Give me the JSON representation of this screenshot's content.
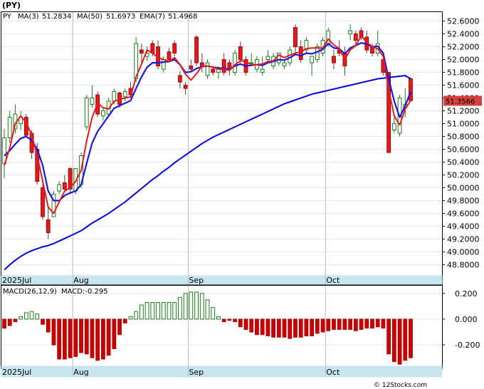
{
  "chart_data": {
    "type": "candlestick",
    "symbol_label": "(PY)",
    "price_legend": {
      "ticker": "PY",
      "ma3_label": "MA(3)",
      "ma3_value": "51.2834",
      "ma50_label": "MA(50)",
      "ma50_value": "51.6973",
      "ema7_label": "EMA(7)",
      "ema7_value": "51.4968"
    },
    "last_price": "51.3566",
    "y_ticks": [
      "52.6000",
      "52.4000",
      "52.2000",
      "52.0000",
      "51.8000",
      "51.6000",
      "51.4000",
      "51.2000",
      "51.0000",
      "50.8000",
      "50.6000",
      "50.4000",
      "50.2000",
      "50.0000",
      "49.8000",
      "49.6000",
      "49.4000",
      "49.2000",
      "49.0000",
      "48.8000"
    ],
    "ylim": [
      48.64,
      52.74
    ],
    "x_labels": [
      {
        "label": "2025Jul",
        "index": 0
      },
      {
        "label": "Aug",
        "index": 13
      },
      {
        "label": "Sep",
        "index": 34
      },
      {
        "label": "Oct",
        "index": 59
      }
    ],
    "colors": {
      "up": "#ffffff",
      "down": "#e41a1c",
      "ma3": "#e41a1c",
      "ma50": "#0000dd",
      "ema7": "#1a1adc",
      "macd_pos": "#1f7a1f",
      "macd_neg": "#cc0000",
      "label_box": "#d84040"
    },
    "candles": [
      {
        "o": 50.38,
        "h": 50.92,
        "l": 50.15,
        "c": 50.78
      },
      {
        "o": 50.78,
        "h": 51.2,
        "l": 50.7,
        "c": 51.1
      },
      {
        "o": 50.92,
        "h": 51.3,
        "l": 50.85,
        "c": 51.15
      },
      {
        "o": 51.0,
        "h": 51.2,
        "l": 50.9,
        "c": 51.1
      },
      {
        "o": 51.1,
        "h": 51.15,
        "l": 50.8,
        "c": 50.82
      },
      {
        "o": 50.85,
        "h": 50.9,
        "l": 50.45,
        "c": 50.55
      },
      {
        "o": 50.6,
        "h": 50.7,
        "l": 50.05,
        "c": 50.1
      },
      {
        "o": 50.0,
        "h": 50.05,
        "l": 49.5,
        "c": 49.55
      },
      {
        "o": 49.5,
        "h": 49.7,
        "l": 49.2,
        "c": 49.3
      },
      {
        "o": 49.55,
        "h": 49.95,
        "l": 49.55,
        "c": 49.9
      },
      {
        "o": 49.95,
        "h": 50.1,
        "l": 49.9,
        "c": 50.05
      },
      {
        "o": 50.08,
        "h": 50.2,
        "l": 49.95,
        "c": 49.98
      },
      {
        "o": 50.3,
        "h": 50.32,
        "l": 49.9,
        "c": 49.98
      },
      {
        "o": 49.95,
        "h": 50.3,
        "l": 49.9,
        "c": 50.3
      },
      {
        "o": 50.05,
        "h": 50.55,
        "l": 50.0,
        "c": 50.5
      },
      {
        "o": 50.95,
        "h": 51.45,
        "l": 50.9,
        "c": 51.4
      },
      {
        "o": 51.3,
        "h": 51.6,
        "l": 51.25,
        "c": 51.4
      },
      {
        "o": 51.45,
        "h": 51.5,
        "l": 51.1,
        "c": 51.15
      },
      {
        "o": 51.12,
        "h": 51.25,
        "l": 51.05,
        "c": 51.2
      },
      {
        "o": 51.15,
        "h": 51.4,
        "l": 51.1,
        "c": 51.35
      },
      {
        "o": 51.35,
        "h": 51.55,
        "l": 51.3,
        "c": 51.5
      },
      {
        "o": 51.48,
        "h": 51.5,
        "l": 51.25,
        "c": 51.3
      },
      {
        "o": 51.42,
        "h": 51.55,
        "l": 51.35,
        "c": 51.5
      },
      {
        "o": 51.55,
        "h": 51.65,
        "l": 51.4,
        "c": 51.45
      },
      {
        "o": 51.7,
        "h": 52.35,
        "l": 51.65,
        "c": 52.25
      },
      {
        "o": 52.15,
        "h": 52.25,
        "l": 51.95,
        "c": 52.1
      },
      {
        "o": 52.05,
        "h": 52.2,
        "l": 51.98,
        "c": 52.1
      },
      {
        "o": 52.25,
        "h": 52.3,
        "l": 52.05,
        "c": 52.1
      },
      {
        "o": 52.2,
        "h": 52.3,
        "l": 51.85,
        "c": 51.9
      },
      {
        "o": 51.85,
        "h": 52.05,
        "l": 51.8,
        "c": 52.0
      },
      {
        "o": 52.12,
        "h": 52.18,
        "l": 51.95,
        "c": 52.0
      },
      {
        "o": 52.25,
        "h": 52.3,
        "l": 52.05,
        "c": 52.1
      },
      {
        "o": 51.75,
        "h": 51.82,
        "l": 51.55,
        "c": 51.65
      },
      {
        "o": 51.6,
        "h": 51.65,
        "l": 51.45,
        "c": 51.55
      },
      {
        "o": 51.9,
        "h": 52.0,
        "l": 51.8,
        "c": 51.85
      },
      {
        "o": 52.35,
        "h": 52.38,
        "l": 51.9,
        "c": 51.95
      },
      {
        "o": 51.95,
        "h": 52.1,
        "l": 51.8,
        "c": 51.9
      },
      {
        "o": 51.75,
        "h": 52.0,
        "l": 51.7,
        "c": 51.95
      },
      {
        "o": 51.85,
        "h": 51.9,
        "l": 51.75,
        "c": 51.8
      },
      {
        "o": 51.8,
        "h": 51.9,
        "l": 51.7,
        "c": 51.85
      },
      {
        "o": 52.0,
        "h": 52.1,
        "l": 51.75,
        "c": 51.8
      },
      {
        "o": 51.95,
        "h": 52.0,
        "l": 51.75,
        "c": 51.85
      },
      {
        "o": 51.8,
        "h": 52.15,
        "l": 51.75,
        "c": 52.1
      },
      {
        "o": 52.2,
        "h": 52.28,
        "l": 51.95,
        "c": 52.0
      },
      {
        "o": 52.0,
        "h": 52.05,
        "l": 51.75,
        "c": 51.8
      },
      {
        "o": 51.95,
        "h": 52.1,
        "l": 51.9,
        "c": 51.95
      },
      {
        "o": 51.85,
        "h": 52.05,
        "l": 51.8,
        "c": 52.0
      },
      {
        "o": 51.8,
        "h": 52.05,
        "l": 51.75,
        "c": 51.85
      },
      {
        "o": 52.0,
        "h": 52.15,
        "l": 51.95,
        "c": 52.05
      },
      {
        "o": 51.9,
        "h": 52.1,
        "l": 51.85,
        "c": 52.05
      },
      {
        "o": 51.95,
        "h": 52.1,
        "l": 51.9,
        "c": 52.1
      },
      {
        "o": 51.9,
        "h": 52.0,
        "l": 51.85,
        "c": 51.95
      },
      {
        "o": 51.95,
        "h": 52.2,
        "l": 51.9,
        "c": 52.15
      },
      {
        "o": 52.5,
        "h": 52.55,
        "l": 52.1,
        "c": 52.2
      },
      {
        "o": 52.2,
        "h": 52.3,
        "l": 51.95,
        "c": 52.0
      },
      {
        "o": 52.15,
        "h": 52.35,
        "l": 52.1,
        "c": 52.3
      },
      {
        "o": 51.95,
        "h": 52.05,
        "l": 51.75,
        "c": 52.05
      },
      {
        "o": 52.0,
        "h": 52.25,
        "l": 51.95,
        "c": 52.2
      },
      {
        "o": 52.1,
        "h": 52.35,
        "l": 52.05,
        "c": 52.3
      },
      {
        "o": 52.25,
        "h": 52.5,
        "l": 52.2,
        "c": 52.45
      },
      {
        "o": 52.05,
        "h": 52.15,
        "l": 51.85,
        "c": 51.95
      },
      {
        "o": 52.15,
        "h": 52.3,
        "l": 52.05,
        "c": 52.1
      },
      {
        "o": 52.1,
        "h": 52.2,
        "l": 51.75,
        "c": 51.9
      },
      {
        "o": 52.4,
        "h": 52.55,
        "l": 52.3,
        "c": 52.45
      },
      {
        "o": 52.4,
        "h": 52.45,
        "l": 52.2,
        "c": 52.3
      },
      {
        "o": 52.45,
        "h": 52.5,
        "l": 52.3,
        "c": 52.35
      },
      {
        "o": 52.35,
        "h": 52.45,
        "l": 52.1,
        "c": 52.15
      },
      {
        "o": 52.2,
        "h": 52.25,
        "l": 52.05,
        "c": 52.1
      },
      {
        "o": 52.1,
        "h": 52.45,
        "l": 52.05,
        "c": 52.25
      },
      {
        "o": 52.0,
        "h": 52.1,
        "l": 51.75,
        "c": 51.8
      },
      {
        "o": 51.8,
        "h": 51.8,
        "l": 50.55,
        "c": 50.55
      },
      {
        "o": 50.9,
        "h": 51.1,
        "l": 50.85,
        "c": 51.0
      },
      {
        "o": 50.85,
        "h": 51.45,
        "l": 50.8,
        "c": 51.4
      },
      {
        "o": 51.25,
        "h": 51.55,
        "l": 51.1,
        "c": 51.3
      },
      {
        "o": 51.7,
        "h": 51.72,
        "l": 51.35,
        "c": 51.36
      }
    ],
    "ma3": [
      50.35,
      50.62,
      51.0,
      51.12,
      51.02,
      50.82,
      50.5,
      50.1,
      49.7,
      49.6,
      49.78,
      49.95,
      50.0,
      50.1,
      50.27,
      50.73,
      51.1,
      51.32,
      51.25,
      51.23,
      51.35,
      51.38,
      51.4,
      51.42,
      51.73,
      51.93,
      52.15,
      52.1,
      52.03,
      52.0,
      51.97,
      52.03,
      51.92,
      51.77,
      51.68,
      51.78,
      51.9,
      51.9,
      51.88,
      51.85,
      51.85,
      51.83,
      51.92,
      51.98,
      51.97,
      51.92,
      51.92,
      51.93,
      51.97,
      51.98,
      52.07,
      52.03,
      52.07,
      52.1,
      52.12,
      52.17,
      52.18,
      52.18,
      52.18,
      52.32,
      52.23,
      52.17,
      52.0,
      52.15,
      52.22,
      52.37,
      52.27,
      52.2,
      52.17,
      52.05,
      51.53,
      51.12,
      50.98,
      51.23,
      51.36
    ],
    "ma50": [
      48.72,
      48.8,
      48.87,
      48.93,
      48.98,
      49.02,
      49.05,
      49.08,
      49.1,
      49.13,
      49.17,
      49.21,
      49.25,
      49.29,
      49.33,
      49.39,
      49.45,
      49.5,
      49.55,
      49.6,
      49.66,
      49.72,
      49.78,
      49.85,
      49.92,
      49.99,
      50.06,
      50.13,
      50.19,
      50.26,
      50.32,
      50.39,
      50.45,
      50.51,
      50.57,
      50.63,
      50.69,
      50.74,
      50.79,
      50.83,
      50.87,
      50.91,
      50.95,
      50.99,
      51.03,
      51.07,
      51.11,
      51.15,
      51.19,
      51.23,
      51.27,
      51.31,
      51.34,
      51.37,
      51.4,
      51.43,
      51.46,
      51.48,
      51.5,
      51.52,
      51.54,
      51.56,
      51.58,
      51.6,
      51.62,
      51.64,
      51.66,
      51.68,
      51.7,
      51.71,
      51.72,
      51.73,
      51.74,
      51.75,
      51.7
    ],
    "ema7": [
      50.5,
      50.58,
      50.68,
      50.77,
      50.8,
      50.74,
      50.6,
      50.35,
      49.95,
      49.8,
      49.8,
      49.88,
      49.92,
      49.95,
      50.05,
      50.38,
      50.7,
      50.88,
      51.0,
      51.12,
      51.24,
      51.28,
      51.32,
      51.36,
      51.55,
      51.73,
      51.88,
      51.95,
      51.95,
      51.96,
      51.97,
      52.0,
      51.92,
      51.8,
      51.81,
      51.86,
      51.89,
      51.9,
      51.88,
      51.87,
      51.86,
      51.85,
      51.9,
      51.93,
      51.9,
      51.91,
      51.92,
      51.91,
      51.95,
      51.97,
      52.0,
      51.99,
      52.03,
      52.08,
      52.06,
      52.1,
      52.09,
      52.12,
      52.16,
      52.25,
      52.18,
      52.17,
      52.09,
      52.18,
      52.22,
      52.26,
      52.24,
      52.2,
      52.21,
      52.1,
      51.7,
      51.35,
      51.1,
      51.28,
      51.5
    ],
    "macd": {
      "label": "MACD(26,12,9)",
      "value_label": "MACD:-0.295",
      "y_ticks": [
        "0.200",
        "0.000",
        "-0.200"
      ],
      "ylim": [
        -0.36,
        0.26
      ],
      "histogram": [
        -0.07,
        -0.05,
        -0.02,
        0.02,
        0.05,
        0.06,
        0.04,
        -0.04,
        -0.1,
        -0.2,
        -0.31,
        -0.31,
        -0.3,
        -0.29,
        -0.26,
        -0.27,
        -0.3,
        -0.32,
        -0.31,
        -0.28,
        -0.23,
        -0.12,
        -0.03,
        0.02,
        0.06,
        0.11,
        0.13,
        0.13,
        0.13,
        0.13,
        0.13,
        0.13,
        0.17,
        0.2,
        0.21,
        0.21,
        0.2,
        0.15,
        0.09,
        0.02,
        -0.02,
        -0.01,
        -0.02,
        -0.06,
        -0.08,
        -0.1,
        -0.12,
        -0.12,
        -0.13,
        -0.14,
        -0.14,
        -0.14,
        -0.15,
        -0.14,
        -0.14,
        -0.13,
        -0.13,
        -0.11,
        -0.1,
        -0.09,
        -0.08,
        -0.08,
        -0.08,
        -0.08,
        -0.09,
        -0.08,
        -0.07,
        -0.07,
        -0.06,
        -0.07,
        -0.27,
        -0.33,
        -0.35,
        -0.32,
        -0.3
      ]
    }
  },
  "watermark": "© 12Stocks.com"
}
